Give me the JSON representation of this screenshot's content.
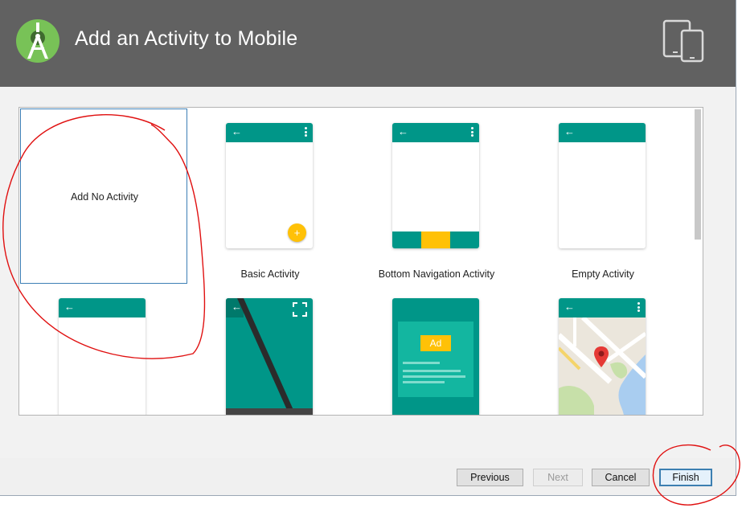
{
  "window": {
    "title": "Add an Activity to Mobile",
    "header_color": "#616161",
    "accent": "#009688"
  },
  "templates": [
    {
      "label": "Add No Activity",
      "selected": true
    },
    {
      "label": "Basic Activity",
      "selected": false
    },
    {
      "label": "Bottom Navigation Activity",
      "selected": false
    },
    {
      "label": "Empty Activity",
      "selected": false
    },
    {
      "label": "",
      "selected": false
    },
    {
      "label": "",
      "selected": false
    },
    {
      "label": "",
      "selected": false
    },
    {
      "label": "",
      "selected": false
    }
  ],
  "badges": {
    "ad": "Ad",
    "fab": "+"
  },
  "buttons": {
    "previous": "Previous",
    "next": "Next",
    "cancel": "Cancel",
    "finish": "Finish"
  },
  "icons": {
    "logo": "android-studio-icon",
    "device": "phone-tablet-icon",
    "back": "back-arrow-icon",
    "overflow": "overflow-menu-icon",
    "fullscreen": "fullscreen-icon",
    "map_pin": "map-pin-icon"
  }
}
